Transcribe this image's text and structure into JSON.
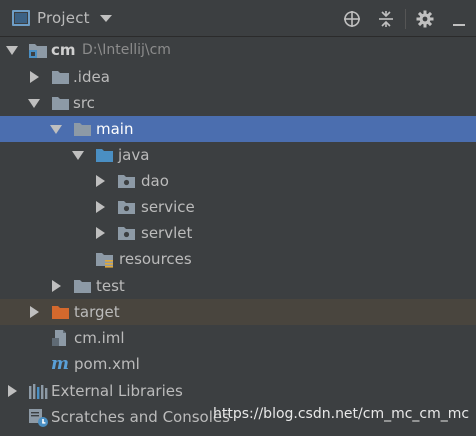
{
  "header": {
    "title": "Project",
    "icons": [
      "project-window-icon",
      "chevron-down-icon",
      "locate-crosshair-icon",
      "collapse-all-icon",
      "gear-icon",
      "hide-panel-icon"
    ]
  },
  "tree": {
    "root": {
      "label": "cm",
      "path": "D:\\Intellij\\cm"
    },
    "idea": "idea",
    "idea_prefix": ".",
    "src": "src",
    "main": "main",
    "java": "java",
    "dao": "dao",
    "service": "service",
    "servlet": "servlet",
    "resources": "resources",
    "test": "test",
    "target": "target",
    "cm_iml": "cm.iml",
    "pom_xml": "pom.xml",
    "external_libraries": "External Libraries",
    "scratches": "Scratches and Consoles"
  },
  "watermark": "https://blog.csdn.net/cm_mc_cm_mc",
  "colors": {
    "background": "#3c3f41",
    "selection": "#4b6eaf",
    "excluded_row": "#49453e",
    "folder_gray": "#8d9aa6",
    "folder_blue": "#4a8fc3",
    "folder_orange": "#d4692d",
    "text": "#bbbbbb"
  }
}
